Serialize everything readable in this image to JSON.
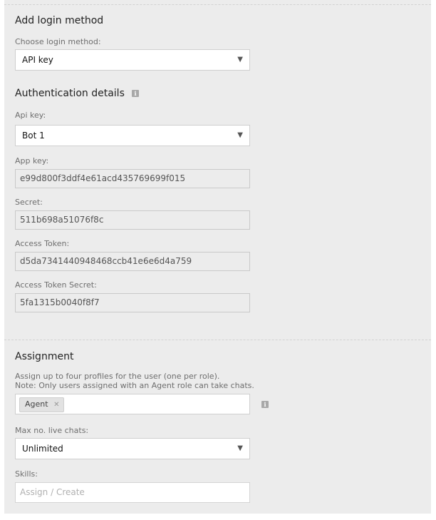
{
  "login_section": {
    "title": "Add login method",
    "choose_label": "Choose login method:",
    "choose_value": "API key"
  },
  "auth_section": {
    "title": "Authentication details",
    "api_key_label": "Api key:",
    "api_key_value": "Bot 1",
    "app_key_label": "App key:",
    "app_key_value": "e99d800f3ddf4e61acd435769699f015",
    "secret_label": "Secret:",
    "secret_value": "511b698a51076f8c",
    "access_token_label": "Access Token:",
    "access_token_value": "d5da7341440948468ccb41e6e6d4a759",
    "access_token_secret_label": "Access Token Secret:",
    "access_token_secret_value": "5fa1315b0040f8f7"
  },
  "assignment_section": {
    "title": "Assignment",
    "help_line1": "Assign up to four profiles for the user (one per role).",
    "help_line2": "Note: Only users assigned with an Agent role can take chats.",
    "profiles": [
      "Agent"
    ],
    "max_chats_label": "Max no. live chats:",
    "max_chats_value": "Unlimited",
    "skills_label": "Skills:",
    "skills_placeholder": "Assign / Create"
  },
  "icons": {
    "info": "info-icon",
    "dropdown": "chevron-down-icon",
    "remove": "close-icon"
  }
}
